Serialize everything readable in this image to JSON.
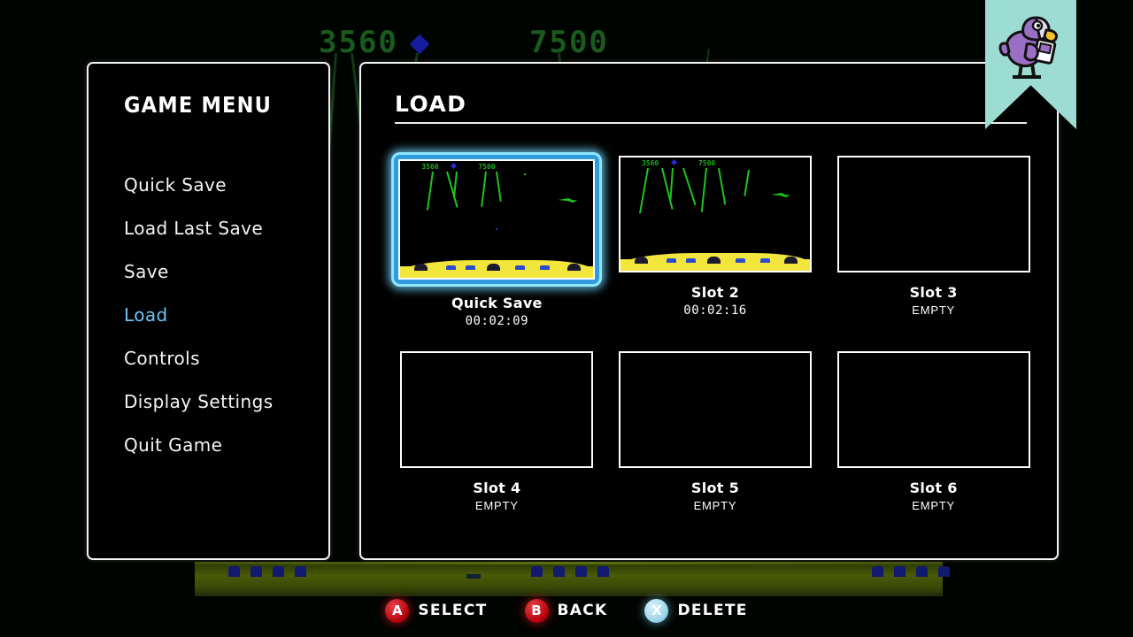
{
  "background": {
    "score_left": "3560",
    "score_right": "7500"
  },
  "sidebar": {
    "title": "GAME MENU",
    "items": [
      {
        "label": "Quick Save",
        "selected": false
      },
      {
        "label": "Load Last Save",
        "selected": false
      },
      {
        "label": "Save",
        "selected": false
      },
      {
        "label": "Load",
        "selected": true
      },
      {
        "label": "Controls",
        "selected": false
      },
      {
        "label": "Display Settings",
        "selected": false
      },
      {
        "label": "Quit Game",
        "selected": false
      }
    ]
  },
  "main": {
    "section_title": "LOAD",
    "slots": [
      {
        "name": "Quick Save",
        "sub": "00:02:09",
        "empty": false,
        "selected": true
      },
      {
        "name": "Slot 2",
        "sub": "00:02:16",
        "empty": false,
        "selected": false
      },
      {
        "name": "Slot 3",
        "sub": "EMPTY",
        "empty": true,
        "selected": false
      },
      {
        "name": "Slot 4",
        "sub": "EMPTY",
        "empty": true,
        "selected": false
      },
      {
        "name": "Slot 5",
        "sub": "EMPTY",
        "empty": true,
        "selected": false
      },
      {
        "name": "Slot 6",
        "sub": "EMPTY",
        "empty": true,
        "selected": false
      }
    ],
    "thumbnail_scores": {
      "left": "3560",
      "right": "7500"
    }
  },
  "hints": [
    {
      "button": "A",
      "label": "SELECT",
      "color": "#b3000b"
    },
    {
      "button": "B",
      "label": "BACK",
      "color": "#b3000b"
    },
    {
      "button": "X",
      "label": "DELETE",
      "color": "#9dd4e8"
    }
  ],
  "bookmark": {
    "icon": "dodo-bird-mascot",
    "ribbon_color": "#9ddcd2",
    "bird_color": "#9b6fc4",
    "beak_color": "#f2c230"
  },
  "colors": {
    "selection": "#6fc3f7",
    "panel_border": "#f2f2f2",
    "background": "#000000"
  }
}
